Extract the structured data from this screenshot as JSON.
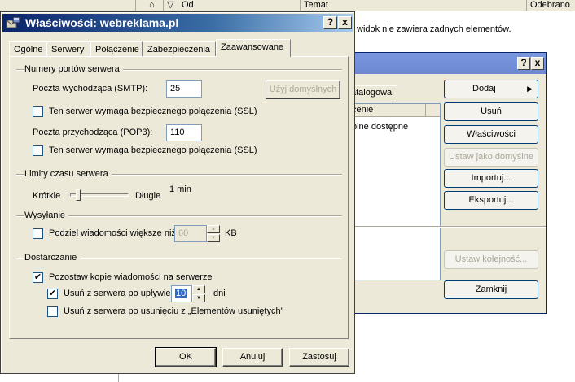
{
  "background": {
    "columns": {
      "date": "Od",
      "subject": "Temat",
      "received": "Odebrano"
    },
    "empty_message": "widok nie zawiera żadnych elementów."
  },
  "accounts_dialog": {
    "help_btn": "?",
    "close_btn": "x",
    "tab_label": "atalogowa",
    "list_header": "cenie",
    "list_row": "plne dostępne",
    "buttons": {
      "add": "Dodaj",
      "remove": "Usuń",
      "properties": "Właściwości",
      "set_default": "Ustaw jako domyślne",
      "import": "Importuj...",
      "export": "Eksportuj...",
      "set_order": "Ustaw kolejność...",
      "close": "Zamknij"
    },
    "add_arrow": "▶"
  },
  "dialog": {
    "title": "Właściwości: webreklama.pl",
    "help_btn": "?",
    "close_btn": "x",
    "tabs": [
      "Ogólne",
      "Serwery",
      "Połączenie",
      "Zabezpieczenia",
      "Zaawansowane"
    ],
    "active_tab": "Zaawansowane",
    "ports": {
      "group": "Numery portów serwera",
      "smtp_label": "Poczta wychodząca (SMTP):",
      "smtp_value": "25",
      "use_defaults": "Użyj domyślnych",
      "smtp_ssl_label": "Ten serwer wymaga bezpiecznego połączenia (SSL)",
      "smtp_ssl_checked": false,
      "pop3_label": "Poczta przychodząca (POP3):",
      "pop3_value": "110",
      "pop3_ssl_label": "Ten serwer wymaga bezpiecznego połączenia (SSL)",
      "pop3_ssl_checked": false
    },
    "timeouts": {
      "group": "Limity czasu serwera",
      "short": "Krótkie",
      "long": "Długie",
      "value": "1 min",
      "slider_level": 0.1
    },
    "sending": {
      "group": "Wysyłanie",
      "split_label": "Podziel wiadomości większe niż",
      "split_checked": false,
      "split_value": "60",
      "unit": "KB"
    },
    "delivery": {
      "group": "Dostarczanie",
      "keep_copy_label": "Pozostaw kopie wiadomości na serwerze",
      "keep_copy_checked": true,
      "remove_after_label": "Usuń z serwera po upływie",
      "remove_after_checked": true,
      "remove_after_value": "10",
      "days": "dni",
      "remove_deleted_label": "Usuń z serwera po usunięciu z „Elementów usuniętych”",
      "remove_deleted_checked": false
    },
    "buttons": {
      "ok": "OK",
      "cancel": "Anuluj",
      "apply": "Zastosuj"
    }
  }
}
